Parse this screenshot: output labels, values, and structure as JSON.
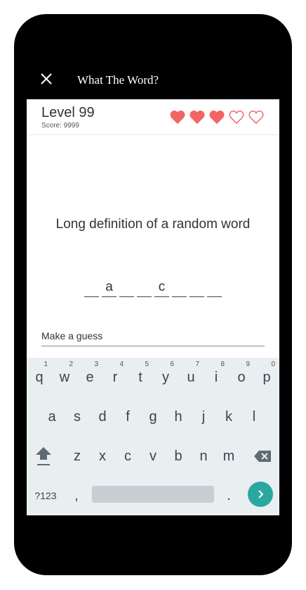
{
  "app": {
    "title": "What The Word?"
  },
  "header": {
    "level": "Level 99",
    "score": "Score: 9999",
    "hearts_filled": 3,
    "hearts_total": 5,
    "heart_color": "#f26565"
  },
  "definition": "Long definition of a random word",
  "blanks": [
    "",
    "a",
    "",
    "",
    "c",
    "",
    "",
    ""
  ],
  "guess": {
    "placeholder": "Make a guess",
    "value": ""
  },
  "keyboard": {
    "row1": [
      {
        "k": "q",
        "h": "1"
      },
      {
        "k": "w",
        "h": "2"
      },
      {
        "k": "e",
        "h": "3"
      },
      {
        "k": "r",
        "h": "4"
      },
      {
        "k": "t",
        "h": "5"
      },
      {
        "k": "y",
        "h": "6"
      },
      {
        "k": "u",
        "h": "7"
      },
      {
        "k": "i",
        "h": "8"
      },
      {
        "k": "o",
        "h": "9"
      },
      {
        "k": "p",
        "h": "0"
      }
    ],
    "row2": [
      "a",
      "s",
      "d",
      "f",
      "g",
      "h",
      "j",
      "k",
      "l"
    ],
    "row3": [
      "z",
      "x",
      "c",
      "v",
      "b",
      "n",
      "m"
    ],
    "symbols_label": "?123",
    "comma": ",",
    "period": ".",
    "accent": "#2aa89f"
  }
}
